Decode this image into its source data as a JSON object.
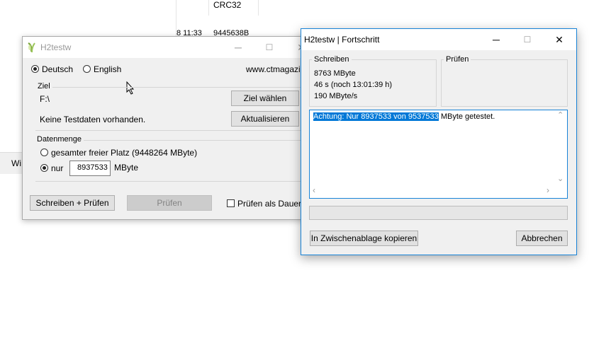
{
  "background": {
    "col_header": "CRC32",
    "row_date": "8 11:33",
    "row_crc": "9445638B",
    "side_label": "Wi"
  },
  "main": {
    "title": "H2testw",
    "lang_de": "Deutsch",
    "lang_en": "English",
    "website": "www.ctmagazin.",
    "ziel_group": "Ziel",
    "ziel_path": "F:\\",
    "ziel_button": "Ziel wählen",
    "status_text": "Keine Testdaten vorhanden.",
    "refresh_button": "Aktualisieren",
    "datenmenge_group": "Datenmenge",
    "option_all": "gesamter freier Platz (9448264 MByte)",
    "option_only": "nur",
    "only_value": "8937533",
    "only_unit": "MByte",
    "write_verify_button": "Schreiben + Prüfen",
    "verify_button": "Prüfen",
    "endless_check": "Prüfen als Dauertest"
  },
  "progress": {
    "title": "H2testw | Fortschritt",
    "write_group": "Schreiben",
    "write_amount": "8763 MByte",
    "write_time": "46 s (noch 13:01:39 h)",
    "write_speed": "190 MByte/s",
    "verify_group": "Prüfen",
    "log_selected": "Achtung: Nur 8937533 von 9537533",
    "log_rest": " MByte getestet.",
    "copy_button": "In Zwischenablage kopieren",
    "cancel_button": "Abbrechen",
    "progress_fraction": 0
  },
  "icons": {
    "minimize": "─",
    "maximize": "☐",
    "close": "✕",
    "scroll_up": "⌃",
    "scroll_down": "⌄",
    "scroll_left": "‹",
    "scroll_right": "›"
  }
}
